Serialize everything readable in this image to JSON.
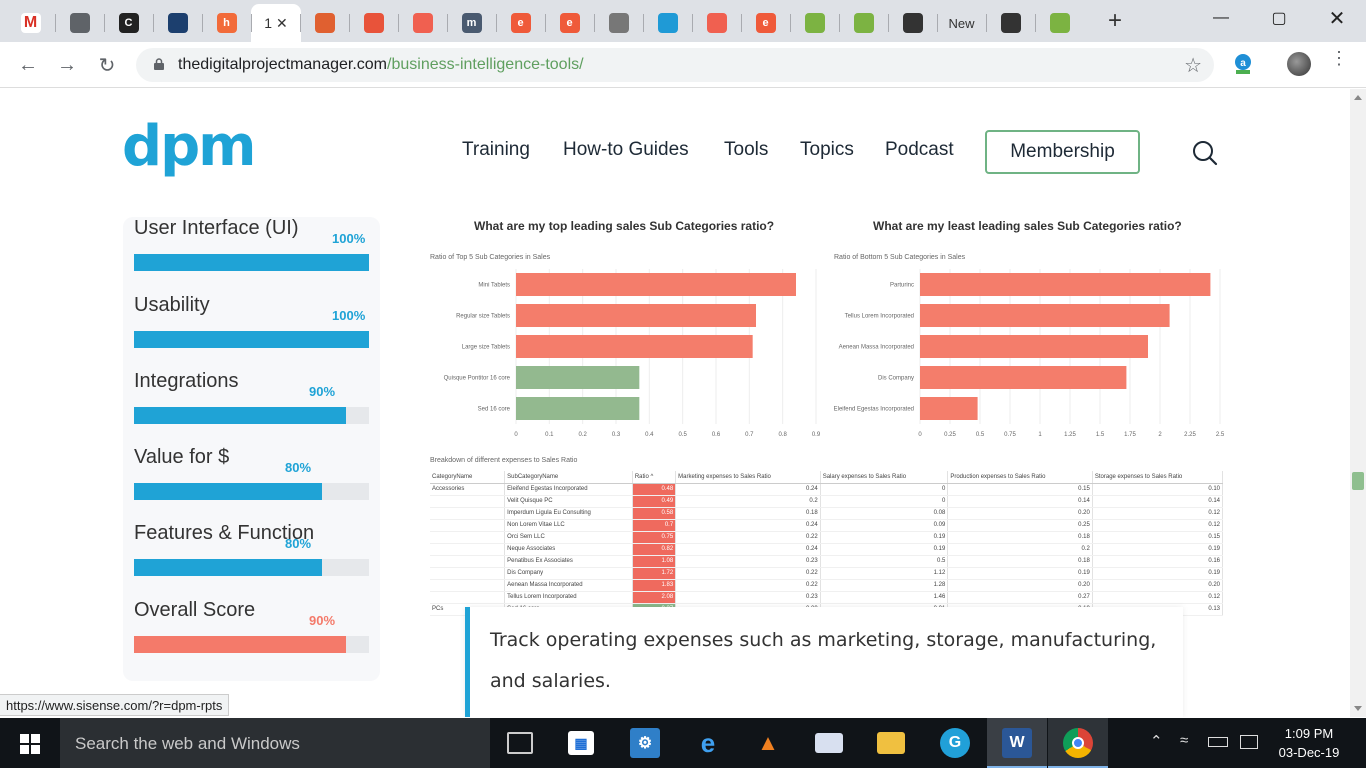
{
  "browser": {
    "tabs": [
      {
        "icon": "gmail-icon",
        "color": "#ffffff",
        "glyph": "M"
      },
      {
        "icon": "globe-icon",
        "color": "#5f6368",
        "glyph": ""
      },
      {
        "icon": "c-icon",
        "color": "#222222",
        "glyph": "C"
      },
      {
        "icon": "link-icon",
        "color": "#1c3f6e",
        "glyph": ""
      },
      {
        "icon": "hubspot-icon",
        "color": "#f26b3a",
        "glyph": "h"
      },
      {
        "icon": "page-icon",
        "color": "#ffffff",
        "glyph": "1",
        "active": true
      },
      {
        "icon": "tool-icon",
        "color": "#e06030",
        "glyph": ""
      },
      {
        "icon": "slides-icon",
        "color": "#e8533a",
        "glyph": ""
      },
      {
        "icon": "hand-icon",
        "color": "#f06050",
        "glyph": ""
      },
      {
        "icon": "m-icon",
        "color": "#4a5a70",
        "glyph": "m"
      },
      {
        "icon": "e-icon",
        "color": "#ef5a3a",
        "glyph": "e"
      },
      {
        "icon": "e-icon",
        "color": "#ef5a3a",
        "glyph": "e"
      },
      {
        "icon": "node-icon",
        "color": "#777777",
        "glyph": ""
      },
      {
        "icon": "swirl-icon",
        "color": "#1f9ad6",
        "glyph": ""
      },
      {
        "icon": "hand-icon",
        "color": "#f06050",
        "glyph": ""
      },
      {
        "icon": "e-icon",
        "color": "#ef5a3a",
        "glyph": "e"
      },
      {
        "icon": "bars-icon",
        "color": "#7cb342",
        "glyph": ""
      },
      {
        "icon": "bars-icon",
        "color": "#7cb342",
        "glyph": ""
      },
      {
        "icon": "chart-icon",
        "color": "#333333",
        "glyph": ""
      },
      {
        "icon": "new-tab-label",
        "color": "#333333",
        "glyph": "New",
        "text": true
      },
      {
        "icon": "chart-icon",
        "color": "#333333",
        "glyph": ""
      },
      {
        "icon": "bars-icon",
        "color": "#7cb342",
        "glyph": ""
      }
    ],
    "active_tab_label": "1",
    "url_domain": "thedigitalprojectmanager.com",
    "url_path": "/business-intelligence-tools/",
    "status_url": "https://www.sisense.com/?r=dpm-rpts"
  },
  "site": {
    "logo": "dpm",
    "nav": [
      "Training",
      "How-to Guides",
      "Tools",
      "Topics",
      "Podcast"
    ],
    "membership": "Membership"
  },
  "scores": [
    {
      "label": "User Interface (UI)",
      "pct": "100%",
      "value": 1.0
    },
    {
      "label": "Usability",
      "pct": "100%",
      "value": 1.0
    },
    {
      "label": "Integrations",
      "pct": "90%",
      "value": 0.9
    },
    {
      "label": "Value for $",
      "pct": "80%",
      "value": 0.8
    },
    {
      "label": "Features & Function",
      "pct": "80%",
      "value": 0.8
    },
    {
      "label": "Overall Score",
      "pct": "90%",
      "value": 0.9
    }
  ],
  "chart_data": [
    {
      "type": "bar",
      "orientation": "horizontal",
      "title": "What are my top leading sales Sub Categories ratio?",
      "subtitle": "Ratio of Top 5 Sub Categories in Sales",
      "categories": [
        "Mini Tablets",
        "Regular size Tablets",
        "Large size Tablets",
        "Quisque Pontitor 16 core",
        "Sed 16 core"
      ],
      "values": [
        0.84,
        0.72,
        0.71,
        0.37,
        0.37
      ],
      "bar_colors": [
        "#f47d6b",
        "#f47d6b",
        "#f47d6b",
        "#93b98f",
        "#93b98f"
      ],
      "xticks": [
        "0",
        "0.1",
        "0.2",
        "0.3",
        "0.4",
        "0.5",
        "0.6",
        "0.7",
        "0.8",
        "0.9"
      ],
      "xlim": [
        0,
        0.9
      ]
    },
    {
      "type": "bar",
      "orientation": "horizontal",
      "title": "What are my least leading sales Sub Categories ratio?",
      "subtitle": "Ratio of Bottom 5 Sub Categories in Sales",
      "categories": [
        "Parturinc",
        "Tellus Lorem Incorporated",
        "Aenean Massa Incorporated",
        "Dis Company",
        "Eleifend Egestas Incorporated"
      ],
      "values": [
        2.42,
        2.08,
        1.9,
        1.72,
        0.48
      ],
      "bar_colors": [
        "#f47d6b",
        "#f47d6b",
        "#f47d6b",
        "#f47d6b",
        "#f47d6b"
      ],
      "xticks": [
        "0",
        "0.25",
        "0.5",
        "0.75",
        "1",
        "1.25",
        "1.5",
        "1.75",
        "2",
        "2.25",
        "2.5"
      ],
      "xlim": [
        0,
        2.5
      ]
    }
  ],
  "table": {
    "title": "Breakdown of different expenses to Sales Ratio",
    "headers": [
      "CategoryName",
      "SubCategoryName",
      "Ratio ^",
      "Marketing expenses to Sales Ratio",
      "Salary expenses to Sales Ratio",
      "Production expenses to Sales Ratio",
      "Storage expenses to Sales Ratio"
    ],
    "rows": [
      [
        "Accessories",
        "Eleifend Egestas Incorporated",
        "0.48",
        "0.24",
        "0",
        "0.15",
        "0.10"
      ],
      [
        "",
        "Velit Quisque PC",
        "0.49",
        "0.2",
        "0",
        "0.14",
        "0.14"
      ],
      [
        "",
        "Imperdum Ligula Eu Consulting",
        "0.58",
        "0.18",
        "0.08",
        "0.20",
        "0.12"
      ],
      [
        "",
        "Non Lorem Vitae LLC",
        "0.7",
        "0.24",
        "0.09",
        "0.25",
        "0.12"
      ],
      [
        "",
        "Orci Sem LLC",
        "0.75",
        "0.22",
        "0.19",
        "0.18",
        "0.15"
      ],
      [
        "",
        "Neque Associates",
        "0.82",
        "0.24",
        "0.19",
        "0.2",
        "0.19"
      ],
      [
        "",
        "Penatibus Ex Associates",
        "1.08",
        "0.23",
        "0.5",
        "0.18",
        "0.16"
      ],
      [
        "",
        "Dis Company",
        "1.72",
        "0.22",
        "1.12",
        "0.19",
        "0.19"
      ],
      [
        "",
        "Aenean Massa Incorporated",
        "1.83",
        "0.22",
        "1.28",
        "0.20",
        "0.20"
      ],
      [
        "",
        "Tellus Lorem Incorporated",
        "2.08",
        "0.23",
        "1.46",
        "0.27",
        "0.12"
      ],
      [
        "PCs",
        "Sed 16 core",
        "0.37",
        "0.09",
        "0.01",
        "0.19",
        "0.13"
      ]
    ]
  },
  "callout": "Track operating expenses such as marketing, storage, manufacturing, and salaries.",
  "taskbar": {
    "search_placeholder": "Search the web and Windows",
    "time": "1:09 PM",
    "date": "03-Dec-19"
  }
}
